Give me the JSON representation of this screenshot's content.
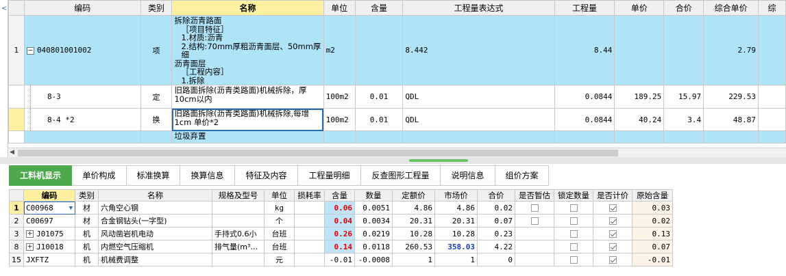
{
  "top_grid": {
    "headers": [
      "编码",
      "类别",
      "名称",
      "单位",
      "含量",
      "工程量表达式",
      "工程量",
      "单价",
      "合价",
      "综合单价",
      "综"
    ],
    "rows": [
      {
        "idx": "1",
        "toggle": "−",
        "code": "040801001002",
        "type": "项",
        "name_lines": [
          "拆除沥青路面",
          "［项目特征］",
          "1.材质:沥青",
          "2.结构:70mm厚粗沥青面层、50mm厚细",
          "沥青面层",
          "［工程内容］",
          "1.拆除"
        ],
        "unit": "m2",
        "content": "",
        "expr": "8.442",
        "qty": "8.44",
        "price": "",
        "total": "",
        "comp_price": "2.79"
      },
      {
        "idx": "",
        "code": "8-3",
        "type": "定",
        "name_lines": [
          "旧路面拆除(沥青类路面)机械拆除，厚",
          "10cm以内"
        ],
        "unit": "100m2",
        "content": "0.01",
        "expr": "QDL",
        "qty": "0.0844",
        "price": "189.25",
        "total": "15.97",
        "comp_price": "229.53"
      },
      {
        "idx": "",
        "code": "8-4 *2",
        "type": "换",
        "name_lines": [
          "旧路面拆除(沥青类路面)机械拆除,每增",
          "1cm  单价*2"
        ],
        "unit": "100m2",
        "content": "0.01",
        "expr": "QDL",
        "qty": "0.0844",
        "price": "40.24",
        "total": "3.4",
        "comp_price": "48.87"
      },
      {
        "idx": "",
        "code": "",
        "type": "",
        "name_lines": [
          "垃圾弃置"
        ],
        "unit": "",
        "content": "",
        "expr": "",
        "qty": "",
        "price": "",
        "total": "",
        "comp_price": ""
      }
    ]
  },
  "tabs": [
    "工料机显示",
    "单价构成",
    "标准换算",
    "换算信息",
    "特征及内容",
    "工程量明细",
    "反查图形工程量",
    "说明信息",
    "组价方案"
  ],
  "bottom_grid": {
    "headers": [
      "",
      "编码",
      "类别",
      "名称",
      "规格及型号",
      "单位",
      "损耗率",
      "含量",
      "数量",
      "定额价",
      "市场价",
      "合价",
      "是否暂估",
      "锁定数量",
      "是否计价",
      "原始含量"
    ],
    "rows": [
      {
        "idx": "1",
        "plus": false,
        "code": "C00968",
        "type": "材",
        "name": "六角空心钢",
        "spec": "",
        "unit": "kg",
        "loss": "",
        "content": "0.06",
        "amount": "0.0051",
        "quota_price": "4.86",
        "market_price": "4.86",
        "total": "0.02",
        "est": false,
        "lock": false,
        "priced": true,
        "orig": "0.03"
      },
      {
        "idx": "2",
        "plus": false,
        "code": "C00697",
        "type": "材",
        "name": "合金钢钻头(一字型)",
        "spec": "",
        "unit": "个",
        "loss": "",
        "content": "0.04",
        "amount": "0.0034",
        "quota_price": "20.31",
        "market_price": "20.31",
        "total": "0.07",
        "est": false,
        "lock": false,
        "priced": true,
        "orig": "0.02"
      },
      {
        "idx": "3",
        "plus": true,
        "code": "J01075",
        "type": "机",
        "name": "风动凿岩机电动",
        "spec": "手持式0.6小",
        "unit": "台班",
        "loss": "",
        "content": "0.26",
        "amount": "0.0219",
        "quota_price": "10.28",
        "market_price": "10.28",
        "total": "0.23",
        "est": null,
        "lock": false,
        "priced": true,
        "orig": "0.13"
      },
      {
        "idx": "8",
        "plus": true,
        "code": "J10018",
        "type": "机",
        "name": "内燃空气压缩机",
        "spec": "排气量(m³…",
        "unit": "台班",
        "loss": "",
        "content": "0.14",
        "amount": "0.0118",
        "quota_price": "260.53",
        "market_price": "358.03",
        "total": "4.22",
        "est": null,
        "lock": false,
        "priced": true,
        "orig": "0.07"
      },
      {
        "idx": "15",
        "plus": false,
        "code": "JXFTZ",
        "type": "机",
        "name": "机械费调整",
        "spec": "",
        "unit": "元",
        "loss": "",
        "content": "-0.01",
        "amount": "-0.0008",
        "quota_price": "1",
        "market_price": "1",
        "total": "0",
        "est": null,
        "lock": false,
        "priced": true,
        "orig": "-0.01"
      }
    ]
  }
}
